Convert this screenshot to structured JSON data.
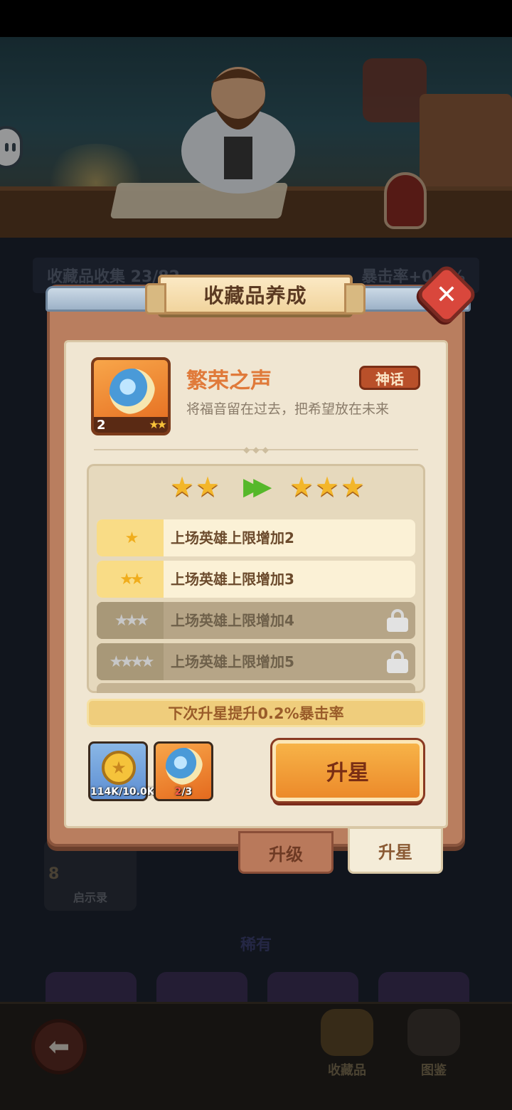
{
  "background": {
    "stat_left": "收藏品收集 23/82",
    "stat_right": "暴击率+0.9%",
    "card": {
      "level": "8",
      "label": "启示录"
    },
    "section_title": "稀有"
  },
  "dialog": {
    "title": "收藏品养成",
    "close_label": "✕",
    "item": {
      "level": "2",
      "name": "繁荣之声",
      "rarity": "神话",
      "description": "将福音留在过去，把希望放在未来"
    },
    "star_upgrade": {
      "current_stars": 2,
      "next_stars": 3,
      "arrow": "▶▶"
    },
    "bonuses": [
      {
        "stars": "★",
        "text": "上场英雄上限增加2",
        "unlocked": true
      },
      {
        "stars": "★★",
        "text": "上场英雄上限增加3",
        "unlocked": true
      },
      {
        "stars": "★★★",
        "text": "上场英雄上限增加4",
        "unlocked": false
      },
      {
        "stars": "★★★★",
        "text": "上场英雄上限增加5",
        "unlocked": false
      }
    ],
    "next_bonus": "下次升星提升0.2%暴击率",
    "costs": {
      "coin": {
        "have": "114K",
        "need": "/10.0K"
      },
      "fragment": {
        "have": "2",
        "need": "/3"
      }
    },
    "upgrade_button": "升星"
  },
  "tabs": [
    {
      "label": "升级",
      "active": false
    },
    {
      "label": "升星",
      "active": true
    }
  ],
  "bottom_nav": {
    "back_icon": "arrow-left-icon",
    "items": [
      {
        "label": "收藏品"
      },
      {
        "label": "图鉴"
      }
    ]
  },
  "colors": {
    "item_name": "#e07a3a",
    "rarity_badge": "#b9502a",
    "star": "#f3b62a",
    "upgrade_button": "#f0a03a",
    "close_button": "#d9473c"
  }
}
